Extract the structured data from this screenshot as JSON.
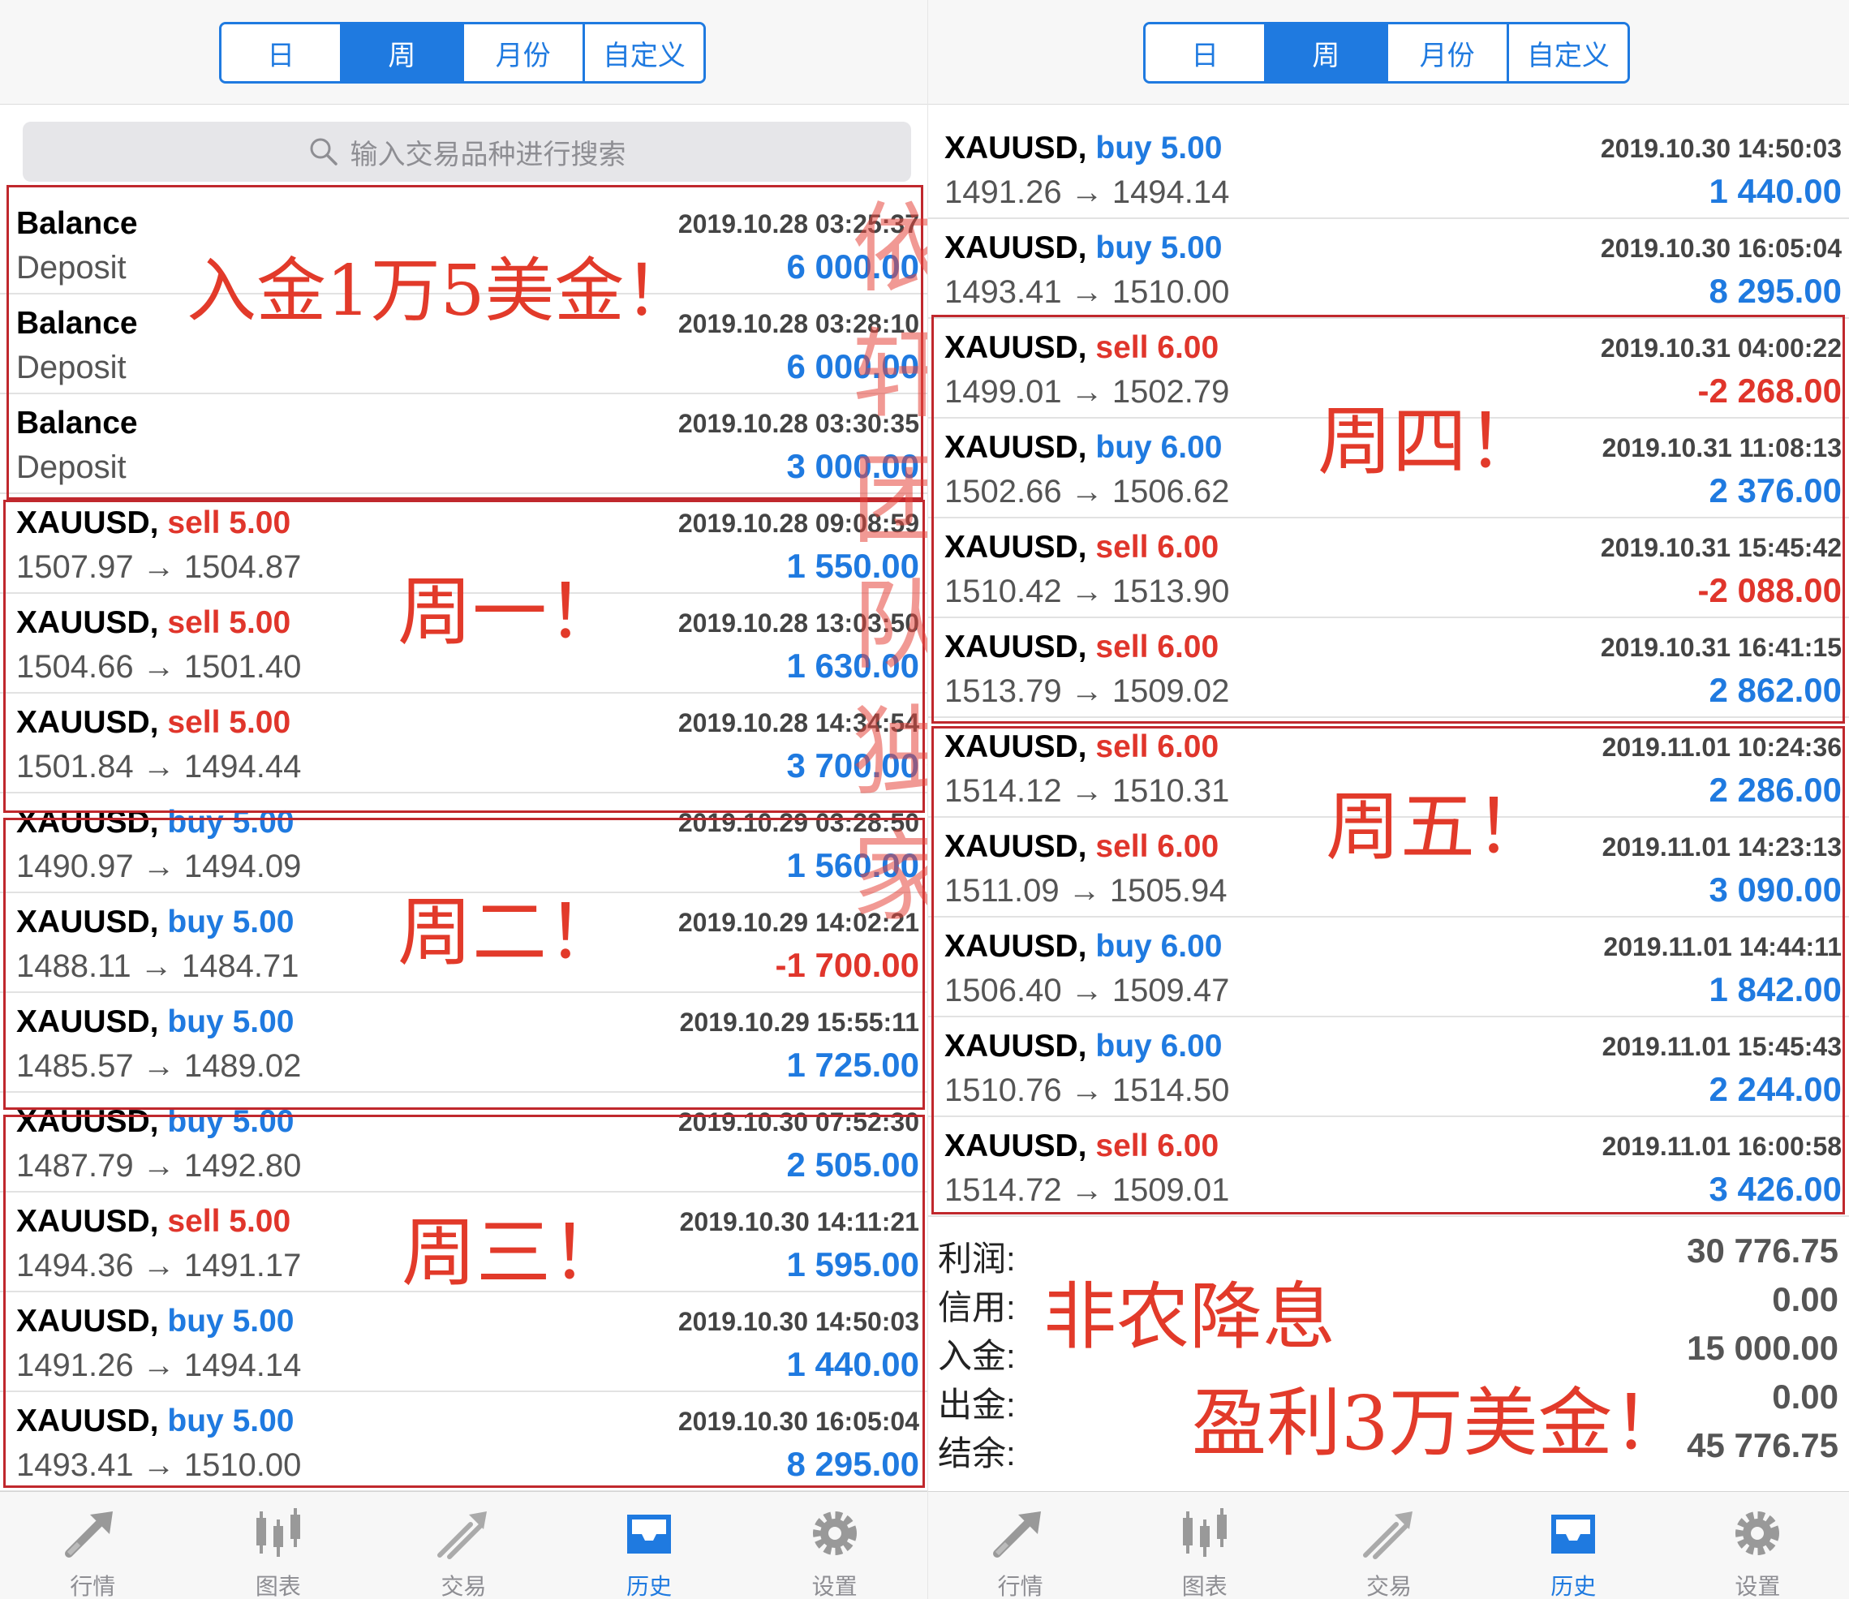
{
  "segments": [
    "日",
    "周",
    "月份",
    "自定义"
  ],
  "active_segment": 1,
  "search_placeholder": "输入交易品种进行搜索",
  "left_rows": [
    {
      "sym": "Balance",
      "dir": "",
      "lots": "",
      "prices": "Deposit",
      "time": "2019.10.28 03:25:37",
      "profit": "6 000.00",
      "neg": false
    },
    {
      "sym": "Balance",
      "dir": "",
      "lots": "",
      "prices": "Deposit",
      "time": "2019.10.28 03:28:10",
      "profit": "6 000.00",
      "neg": false
    },
    {
      "sym": "Balance",
      "dir": "",
      "lots": "",
      "prices": "Deposit",
      "time": "2019.10.28 03:30:35",
      "profit": "3 000.00",
      "neg": false
    },
    {
      "sym": "XAUUSD,",
      "dir": "sell",
      "lots": "5.00",
      "prices": "1507.97 → 1504.87",
      "time": "2019.10.28 09:08:59",
      "profit": "1 550.00",
      "neg": false
    },
    {
      "sym": "XAUUSD,",
      "dir": "sell",
      "lots": "5.00",
      "prices": "1504.66 → 1501.40",
      "time": "2019.10.28 13:03:50",
      "profit": "1 630.00",
      "neg": false
    },
    {
      "sym": "XAUUSD,",
      "dir": "sell",
      "lots": "5.00",
      "prices": "1501.84 → 1494.44",
      "time": "2019.10.28 14:34:54",
      "profit": "3 700.00",
      "neg": false
    },
    {
      "sym": "XAUUSD,",
      "dir": "buy",
      "lots": "5.00",
      "prices": "1490.97 → 1494.09",
      "time": "2019.10.29 03:28:50",
      "profit": "1 560.00",
      "neg": false
    },
    {
      "sym": "XAUUSD,",
      "dir": "buy",
      "lots": "5.00",
      "prices": "1488.11 → 1484.71",
      "time": "2019.10.29 14:02:21",
      "profit": "-1 700.00",
      "neg": true
    },
    {
      "sym": "XAUUSD,",
      "dir": "buy",
      "lots": "5.00",
      "prices": "1485.57 → 1489.02",
      "time": "2019.10.29 15:55:11",
      "profit": "1 725.00",
      "neg": false
    },
    {
      "sym": "XAUUSD,",
      "dir": "buy",
      "lots": "5.00",
      "prices": "1487.79 → 1492.80",
      "time": "2019.10.30 07:52:30",
      "profit": "2 505.00",
      "neg": false
    },
    {
      "sym": "XAUUSD,",
      "dir": "sell",
      "lots": "5.00",
      "prices": "1494.36 → 1491.17",
      "time": "2019.10.30 14:11:21",
      "profit": "1 595.00",
      "neg": false
    },
    {
      "sym": "XAUUSD,",
      "dir": "buy",
      "lots": "5.00",
      "prices": "1491.26 → 1494.14",
      "time": "2019.10.30 14:50:03",
      "profit": "1 440.00",
      "neg": false
    },
    {
      "sym": "XAUUSD,",
      "dir": "buy",
      "lots": "5.00",
      "prices": "1493.41 → 1510.00",
      "time": "2019.10.30 16:05:04",
      "profit": "8 295.00",
      "neg": false
    }
  ],
  "right_rows": [
    {
      "sym": "XAUUSD,",
      "dir": "buy",
      "lots": "5.00",
      "prices": "1491.26 → 1494.14",
      "time": "2019.10.30 14:50:03",
      "profit": "1 440.00",
      "neg": false
    },
    {
      "sym": "XAUUSD,",
      "dir": "buy",
      "lots": "5.00",
      "prices": "1493.41 → 1510.00",
      "time": "2019.10.30 16:05:04",
      "profit": "8 295.00",
      "neg": false
    },
    {
      "sym": "XAUUSD,",
      "dir": "sell",
      "lots": "6.00",
      "prices": "1499.01 → 1502.79",
      "time": "2019.10.31 04:00:22",
      "profit": "-2 268.00",
      "neg": true
    },
    {
      "sym": "XAUUSD,",
      "dir": "buy",
      "lots": "6.00",
      "prices": "1502.66 → 1506.62",
      "time": "2019.10.31 11:08:13",
      "profit": "2 376.00",
      "neg": false
    },
    {
      "sym": "XAUUSD,",
      "dir": "sell",
      "lots": "6.00",
      "prices": "1510.42 → 1513.90",
      "time": "2019.10.31 15:45:42",
      "profit": "-2 088.00",
      "neg": true
    },
    {
      "sym": "XAUUSD,",
      "dir": "sell",
      "lots": "6.00",
      "prices": "1513.79 → 1509.02",
      "time": "2019.10.31 16:41:15",
      "profit": "2 862.00",
      "neg": false
    },
    {
      "sym": "XAUUSD,",
      "dir": "sell",
      "lots": "6.00",
      "prices": "1514.12 → 1510.31",
      "time": "2019.11.01 10:24:36",
      "profit": "2 286.00",
      "neg": false
    },
    {
      "sym": "XAUUSD,",
      "dir": "sell",
      "lots": "6.00",
      "prices": "1511.09 → 1505.94",
      "time": "2019.11.01 14:23:13",
      "profit": "3 090.00",
      "neg": false
    },
    {
      "sym": "XAUUSD,",
      "dir": "buy",
      "lots": "6.00",
      "prices": "1506.40 → 1509.47",
      "time": "2019.11.01 14:44:11",
      "profit": "1 842.00",
      "neg": false
    },
    {
      "sym": "XAUUSD,",
      "dir": "buy",
      "lots": "6.00",
      "prices": "1510.76 → 1514.50",
      "time": "2019.11.01 15:45:43",
      "profit": "2 244.00",
      "neg": false
    },
    {
      "sym": "XAUUSD,",
      "dir": "sell",
      "lots": "6.00",
      "prices": "1514.72 → 1509.01",
      "time": "2019.11.01 16:00:58",
      "profit": "3 426.00",
      "neg": false
    }
  ],
  "summary": [
    {
      "label": "利润:",
      "value": "30 776.75"
    },
    {
      "label": "信用:",
      "value": "0.00"
    },
    {
      "label": "入金:",
      "value": "15 000.00"
    },
    {
      "label": "出金:",
      "value": "0.00"
    },
    {
      "label": "结余:",
      "value": "45 776.75"
    }
  ],
  "tabbar": [
    {
      "label": "行情",
      "icon": "quotes-icon"
    },
    {
      "label": "图表",
      "icon": "chart-icon"
    },
    {
      "label": "交易",
      "icon": "trade-icon"
    },
    {
      "label": "历史",
      "icon": "history-icon"
    },
    {
      "label": "设置",
      "icon": "settings-icon"
    }
  ],
  "active_tab": 3,
  "annotations": {
    "deposit": "入金1万5美金！",
    "mon": "周一！",
    "tue": "周二！",
    "wed": "周三！",
    "thu": "周四！",
    "fri": "周五！",
    "nfp": "非农降息",
    "profit": "盈利3万美金！",
    "watermark": "依轩团队独家"
  },
  "colors": {
    "accent": "#1f7ae0",
    "loss": "#e0352b",
    "annotation": "#e23a2a"
  }
}
